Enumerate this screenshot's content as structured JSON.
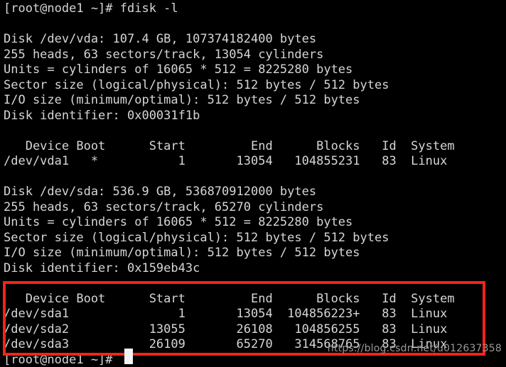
{
  "terminal": {
    "background_color": "#000000",
    "text_color": "#d6d6d6",
    "prompt": "[root@node1 ~]#",
    "command": "fdisk -l",
    "command_line": "[root@node1 ~]# fdisk -l",
    "final_prompt_line": "[root@node1 ~]#",
    "console_output": "[root@node1 ~]# fdisk -l\n\nDisk /dev/vda: 107.4 GB, 107374182400 bytes\n255 heads, 63 sectors/track, 13054 cylinders\nUnits = cylinders of 16065 * 512 = 8225280 bytes\nSector size (logical/physical): 512 bytes / 512 bytes\nI/O size (minimum/optimal): 512 bytes / 512 bytes\nDisk identifier: 0x00031f1b\n\n   Device Boot      Start         End      Blocks   Id  System\n/dev/vda1   *           1       13054   104855231   83  Linux\n\nDisk /dev/sda: 536.9 GB, 536870912000 bytes\n255 heads, 63 sectors/track, 65270 cylinders\nUnits = cylinders of 16065 * 512 = 8225280 bytes\nSector size (logical/physical): 512 bytes / 512 bytes\nI/O size (minimum/optimal): 512 bytes / 512 bytes\nDisk identifier: 0x159eb43c\n\n   Device Boot      Start         End      Blocks   Id  System\n/dev/sda1               1       13054  104856223+   83  Linux\n/dev/sda2           13055       26108   104856255   83  Linux\n/dev/sda3           26109       65270   314568765   83  Linux\n[root@node1 ~]#"
  },
  "disks": [
    {
      "device": "/dev/vda",
      "size_human": "107.4 GB",
      "size_bytes": "107374182400 bytes",
      "heads": "255",
      "sectors_per_track": "63",
      "cylinders": "13054",
      "units_line": "Units = cylinders of 16065 * 512 = 8225280 bytes",
      "sector_size_line": "Sector size (logical/physical): 512 bytes / 512 bytes",
      "io_size_line": "I/O size (minimum/optimal): 512 bytes / 512 bytes",
      "identifier": "0x00031f1b",
      "partition_table": {
        "headers": [
          "Device",
          "Boot",
          "Start",
          "End",
          "Blocks",
          "Id",
          "System"
        ],
        "rows": [
          {
            "device": "/dev/vda1",
            "boot": "*",
            "start": "1",
            "end": "13054",
            "blocks": "104855231",
            "id": "83",
            "system": "Linux"
          }
        ]
      }
    },
    {
      "device": "/dev/sda",
      "size_human": "536.9 GB",
      "size_bytes": "536870912000 bytes",
      "heads": "255",
      "sectors_per_track": "63",
      "cylinders": "65270",
      "units_line": "Units = cylinders of 16065 * 512 = 8225280 bytes",
      "sector_size_line": "Sector size (logical/physical): 512 bytes / 512 bytes",
      "io_size_line": "I/O size (minimum/optimal): 512 bytes / 512 bytes",
      "identifier": "0x159eb43c",
      "partition_table": {
        "headers": [
          "Device",
          "Boot",
          "Start",
          "End",
          "Blocks",
          "Id",
          "System"
        ],
        "rows": [
          {
            "device": "/dev/sda1",
            "boot": "",
            "start": "1",
            "end": "13054",
            "blocks": "104856223+",
            "id": "83",
            "system": "Linux"
          },
          {
            "device": "/dev/sda2",
            "boot": "",
            "start": "13055",
            "end": "26108",
            "blocks": "104856255",
            "id": "83",
            "system": "Linux"
          },
          {
            "device": "/dev/sda3",
            "boot": "",
            "start": "26109",
            "end": "65270",
            "blocks": "314568765",
            "id": "83",
            "system": "Linux"
          }
        ]
      }
    }
  ],
  "annotation": {
    "type": "rectangle-highlight",
    "color": "#f22418",
    "target": "sda partition table"
  },
  "watermark": {
    "text": "https://blog.csdn.net/u012637358",
    "color": "#9a9a9a"
  },
  "cursor": {
    "style": "block",
    "color": "#f2f2f2"
  }
}
